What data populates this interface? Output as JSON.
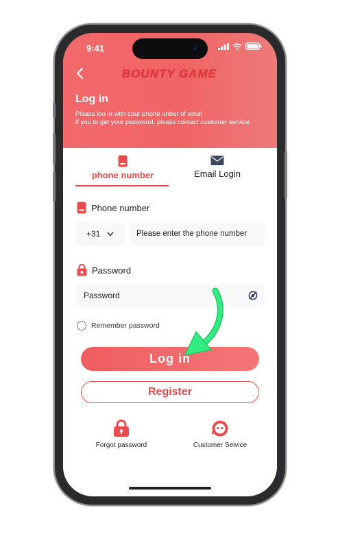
{
  "status": {
    "time": "9:41"
  },
  "header": {
    "brand": "BOUNTY GAME",
    "title": "Log in",
    "subtitle_line1": "Pleass loo in with cour phone unber of emal",
    "subtitle_line2": "lf you to get your password, pleass contact customer service"
  },
  "tabs": [
    {
      "label": "phone number",
      "icon": "phone-icon",
      "active": true
    },
    {
      "label": "Email Login",
      "icon": "envelope-icon",
      "active": false
    }
  ],
  "phone": {
    "label": "Phone number",
    "country_code": "+31",
    "placeholder": "Please enter the phone number"
  },
  "password": {
    "label": "Password",
    "placeholder": "Password"
  },
  "remember": {
    "label": "Remember password"
  },
  "buttons": {
    "login": "Log in",
    "register": "Register"
  },
  "footer_links": [
    {
      "label": "Forgot password",
      "icon": "lock-icon"
    },
    {
      "label": "Customer Seivice",
      "icon": "customer-service-icon"
    }
  ],
  "colors": {
    "accent": "#e8474a",
    "header_gradient_start": "#f3686a",
    "arrow": "#2ee57a"
  }
}
